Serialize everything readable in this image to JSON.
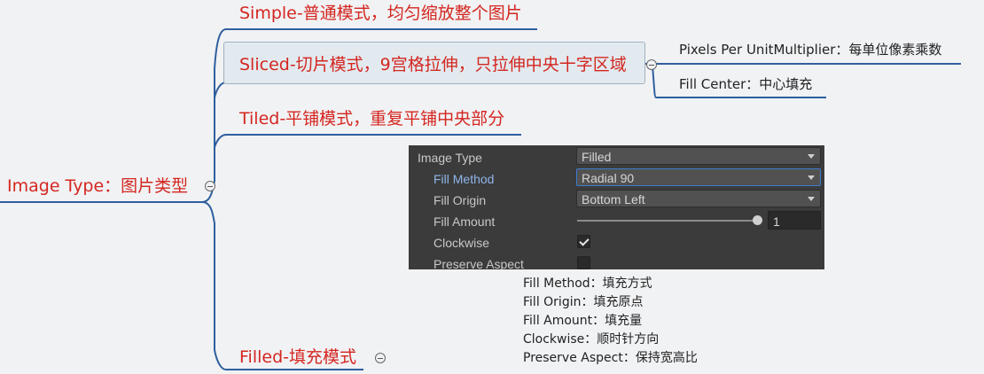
{
  "root": {
    "label": "Image Type：图片类型"
  },
  "branches": {
    "simple": {
      "label": "Simple-普通模式，均匀缩放整个图片"
    },
    "sliced": {
      "label": "Sliced-切片模式，9宫格拉伸，只拉伸中央十字区域",
      "children": [
        "Pixels Per UnitMultiplier：每单位像素乘数",
        "Fill Center：中心填充"
      ]
    },
    "tiled": {
      "label": "Tiled-平铺模式，重复平铺中央部分"
    },
    "filled": {
      "label": "Filled-填充模式",
      "notes": [
        "Fill Method：填充方式",
        "Fill Origin：填充原点",
        "Fill Amount：填充量",
        "Clockwise：顺时针方向",
        "Preserve Aspect：保持宽高比"
      ]
    }
  },
  "inspector": {
    "image_type": {
      "label": "Image Type",
      "value": "Filled"
    },
    "fill_method": {
      "label": "Fill Method",
      "value": "Radial 90"
    },
    "fill_origin": {
      "label": "Fill Origin",
      "value": "Bottom Left"
    },
    "fill_amount": {
      "label": "Fill Amount",
      "value": "1",
      "fraction": 1.0
    },
    "clockwise": {
      "label": "Clockwise",
      "checked": true
    },
    "preserve_aspect": {
      "label": "Preserve Aspect",
      "checked": false
    }
  },
  "colors": {
    "branch_text": "#d42620",
    "underline": "#2f5f9e",
    "panel_bg": "#3b3b3b",
    "focus_border": "#3d7ccf"
  },
  "icons": {
    "collapse": "collapse-circle-icon",
    "check": "checkmark-icon",
    "dropdown": "dropdown-arrow-icon"
  }
}
